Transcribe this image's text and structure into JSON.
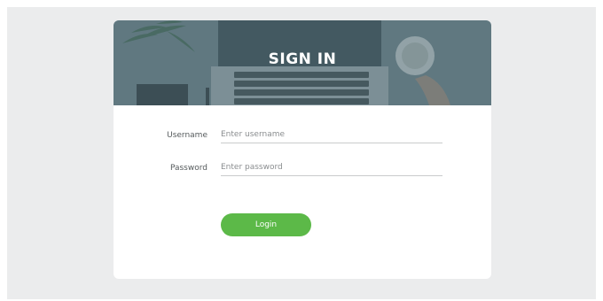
{
  "header": {
    "title": "SIGN IN"
  },
  "form": {
    "username": {
      "label": "Username",
      "placeholder": "Enter username",
      "value": ""
    },
    "password": {
      "label": "Password",
      "placeholder": "Enter password",
      "value": ""
    },
    "login_label": "Login"
  },
  "colors": {
    "background": "#ebeced",
    "card": "#ffffff",
    "accent": "#5cb948",
    "hero_overlay": "#4a6670"
  }
}
